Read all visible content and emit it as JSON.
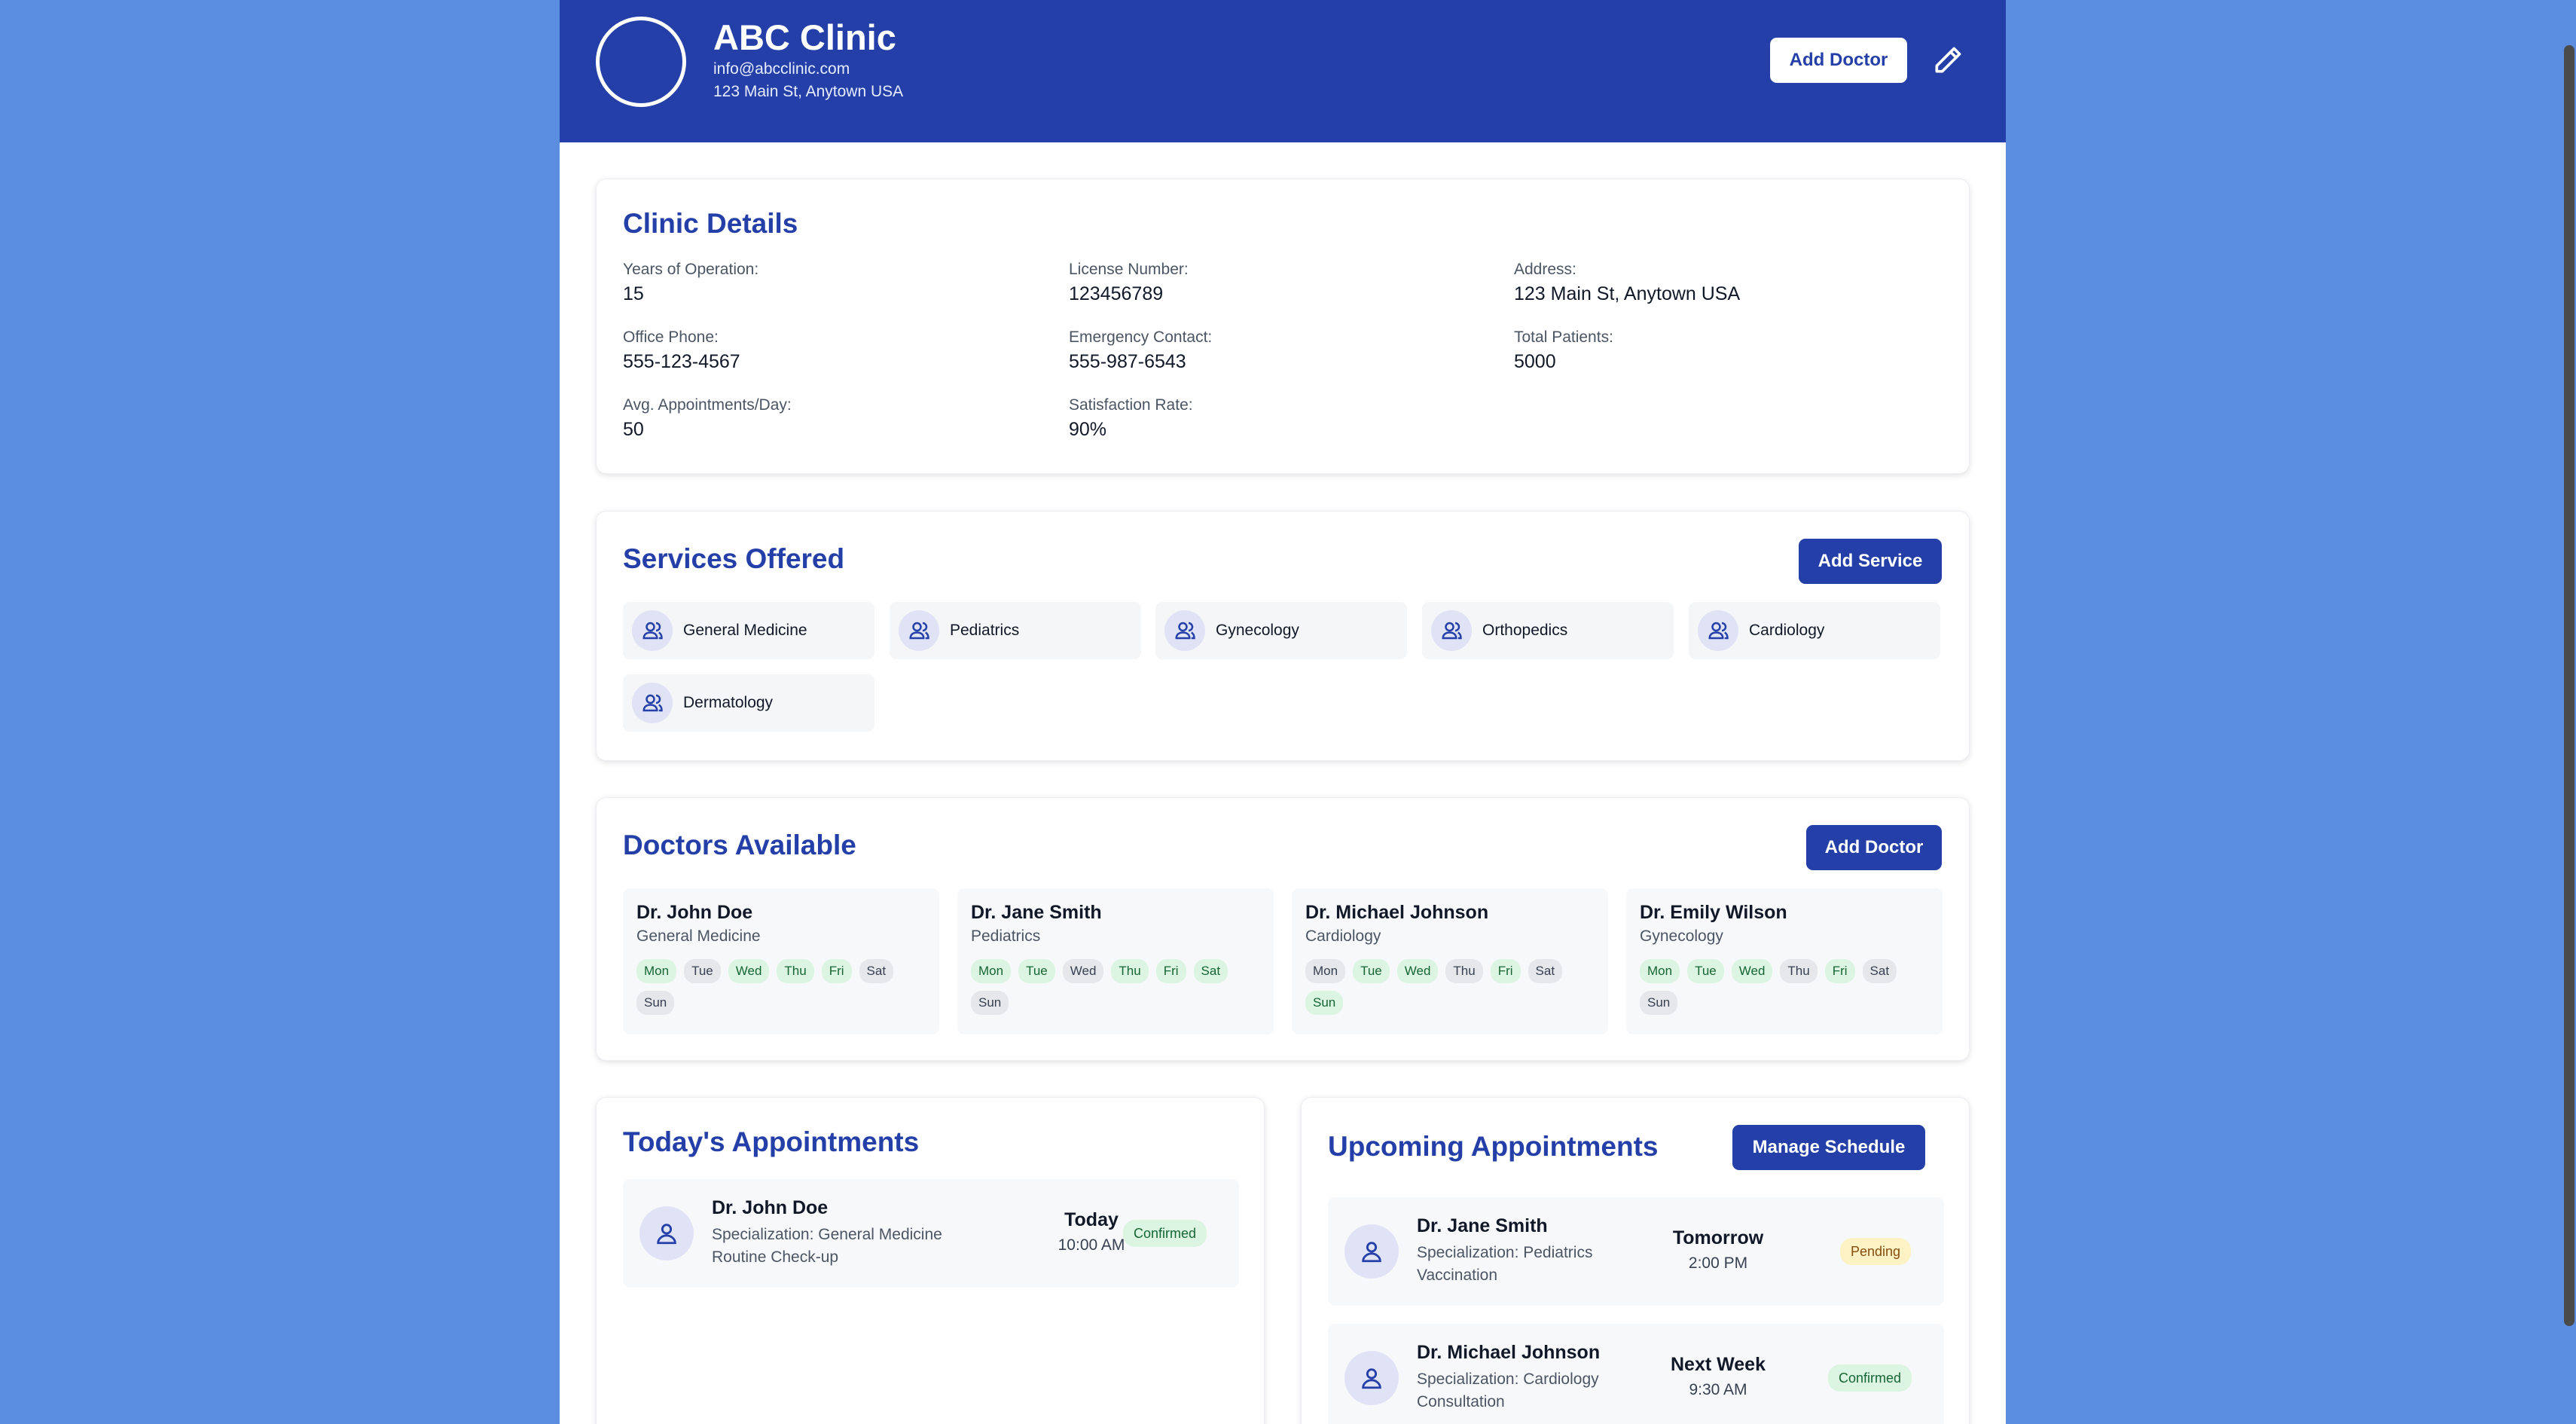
{
  "header": {
    "clinic_name": "ABC Clinic",
    "email": "info@abcclinic.com",
    "address": "123 Main St, Anytown USA",
    "add_doctor_label": "Add Doctor"
  },
  "clinic_details": {
    "title": "Clinic Details",
    "fields": [
      {
        "label": "Years of Operation:",
        "value": "15"
      },
      {
        "label": "License Number:",
        "value": "123456789"
      },
      {
        "label": "Address:",
        "value": "123 Main St, Anytown USA"
      },
      {
        "label": "Office Phone:",
        "value": "555-123-4567"
      },
      {
        "label": "Emergency Contact:",
        "value": "555-987-6543"
      },
      {
        "label": "Total Patients:",
        "value": "5000"
      },
      {
        "label": "Avg. Appointments/Day:",
        "value": "50"
      },
      {
        "label": "Satisfaction Rate:",
        "value": "90%"
      }
    ]
  },
  "services": {
    "title": "Services Offered",
    "add_label": "Add Service",
    "items": [
      "General Medicine",
      "Pediatrics",
      "Gynecology",
      "Orthopedics",
      "Cardiology",
      "Dermatology"
    ]
  },
  "doctors": {
    "title": "Doctors Available",
    "add_label": "Add Doctor",
    "day_labels": [
      "Mon",
      "Tue",
      "Wed",
      "Thu",
      "Fri",
      "Sat",
      "Sun"
    ],
    "items": [
      {
        "name": "Dr. John Doe",
        "specialization": "General Medicine",
        "available": [
          true,
          false,
          true,
          true,
          true,
          false,
          false
        ]
      },
      {
        "name": "Dr. Jane Smith",
        "specialization": "Pediatrics",
        "available": [
          true,
          true,
          false,
          true,
          true,
          true,
          false
        ]
      },
      {
        "name": "Dr. Michael Johnson",
        "specialization": "Cardiology",
        "available": [
          false,
          true,
          true,
          false,
          true,
          false,
          true
        ]
      },
      {
        "name": "Dr. Emily Wilson",
        "specialization": "Gynecology",
        "available": [
          true,
          true,
          true,
          false,
          true,
          false,
          false
        ]
      }
    ]
  },
  "today": {
    "title": "Today's Appointments",
    "items": [
      {
        "doctor": "Dr. John Doe",
        "specialization": "Specialization: General Medicine",
        "reason": "Routine Check-up",
        "when": "Today",
        "time": "10:00 AM",
        "status": "Confirmed"
      }
    ]
  },
  "upcoming": {
    "title": "Upcoming Appointments",
    "manage_label": "Manage Schedule",
    "items": [
      {
        "doctor": "Dr. Jane Smith",
        "specialization": "Specialization: Pediatrics",
        "reason": "Vaccination",
        "when": "Tomorrow",
        "time": "2:00 PM",
        "status": "Pending"
      },
      {
        "doctor": "Dr. Michael Johnson",
        "specialization": "Specialization: Cardiology",
        "reason": "Consultation",
        "when": "Next Week",
        "time": "9:30 AM",
        "status": "Confirmed"
      }
    ]
  },
  "colors": {
    "brand": "#2440a8",
    "background": "#5b8de0",
    "confirmed": "#dcf5e3",
    "pending": "#fdf2c3"
  }
}
